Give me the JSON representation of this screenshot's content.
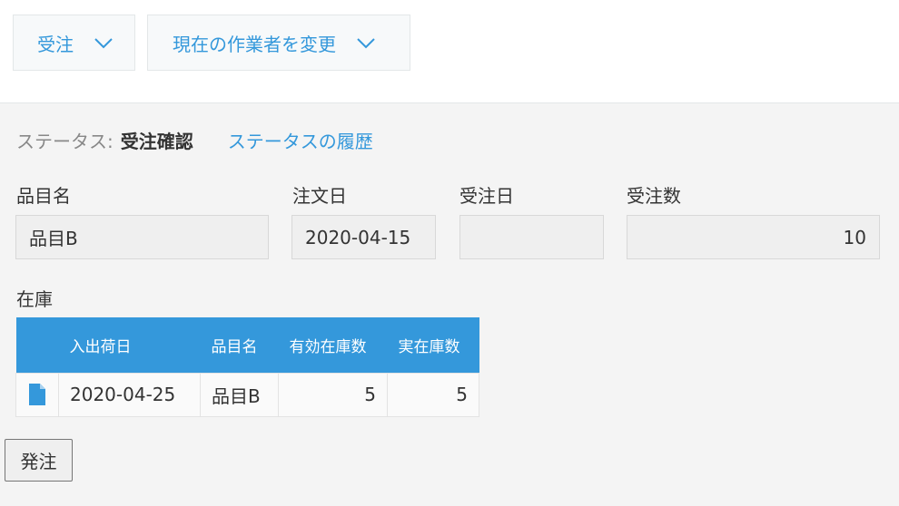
{
  "toolbar": {
    "action_label": "受注",
    "assignee_label": "現在の作業者を変更"
  },
  "status": {
    "label": "ステータス:",
    "value": "受注確認",
    "history_link": "ステータスの履歴"
  },
  "fields": {
    "item_name": {
      "label": "品目名",
      "value": "品目B"
    },
    "order_date": {
      "label": "注文日",
      "value": "2020-04-15"
    },
    "received_date": {
      "label": "受注日",
      "value": ""
    },
    "quantity": {
      "label": "受注数",
      "value": "10"
    }
  },
  "stock": {
    "label": "在庫",
    "columns": [
      "",
      "入出荷日",
      "品目名",
      "有効在庫数",
      "実在庫数"
    ],
    "rows": [
      {
        "date": "2020-04-25",
        "item": "品目B",
        "available": "5",
        "actual": "5"
      }
    ]
  },
  "order_button_label": "発注",
  "colors": {
    "accent": "#3498db",
    "background": "#f4f4f4"
  },
  "icons": {
    "dropdown": "chevron-down-icon",
    "record": "file-icon"
  }
}
